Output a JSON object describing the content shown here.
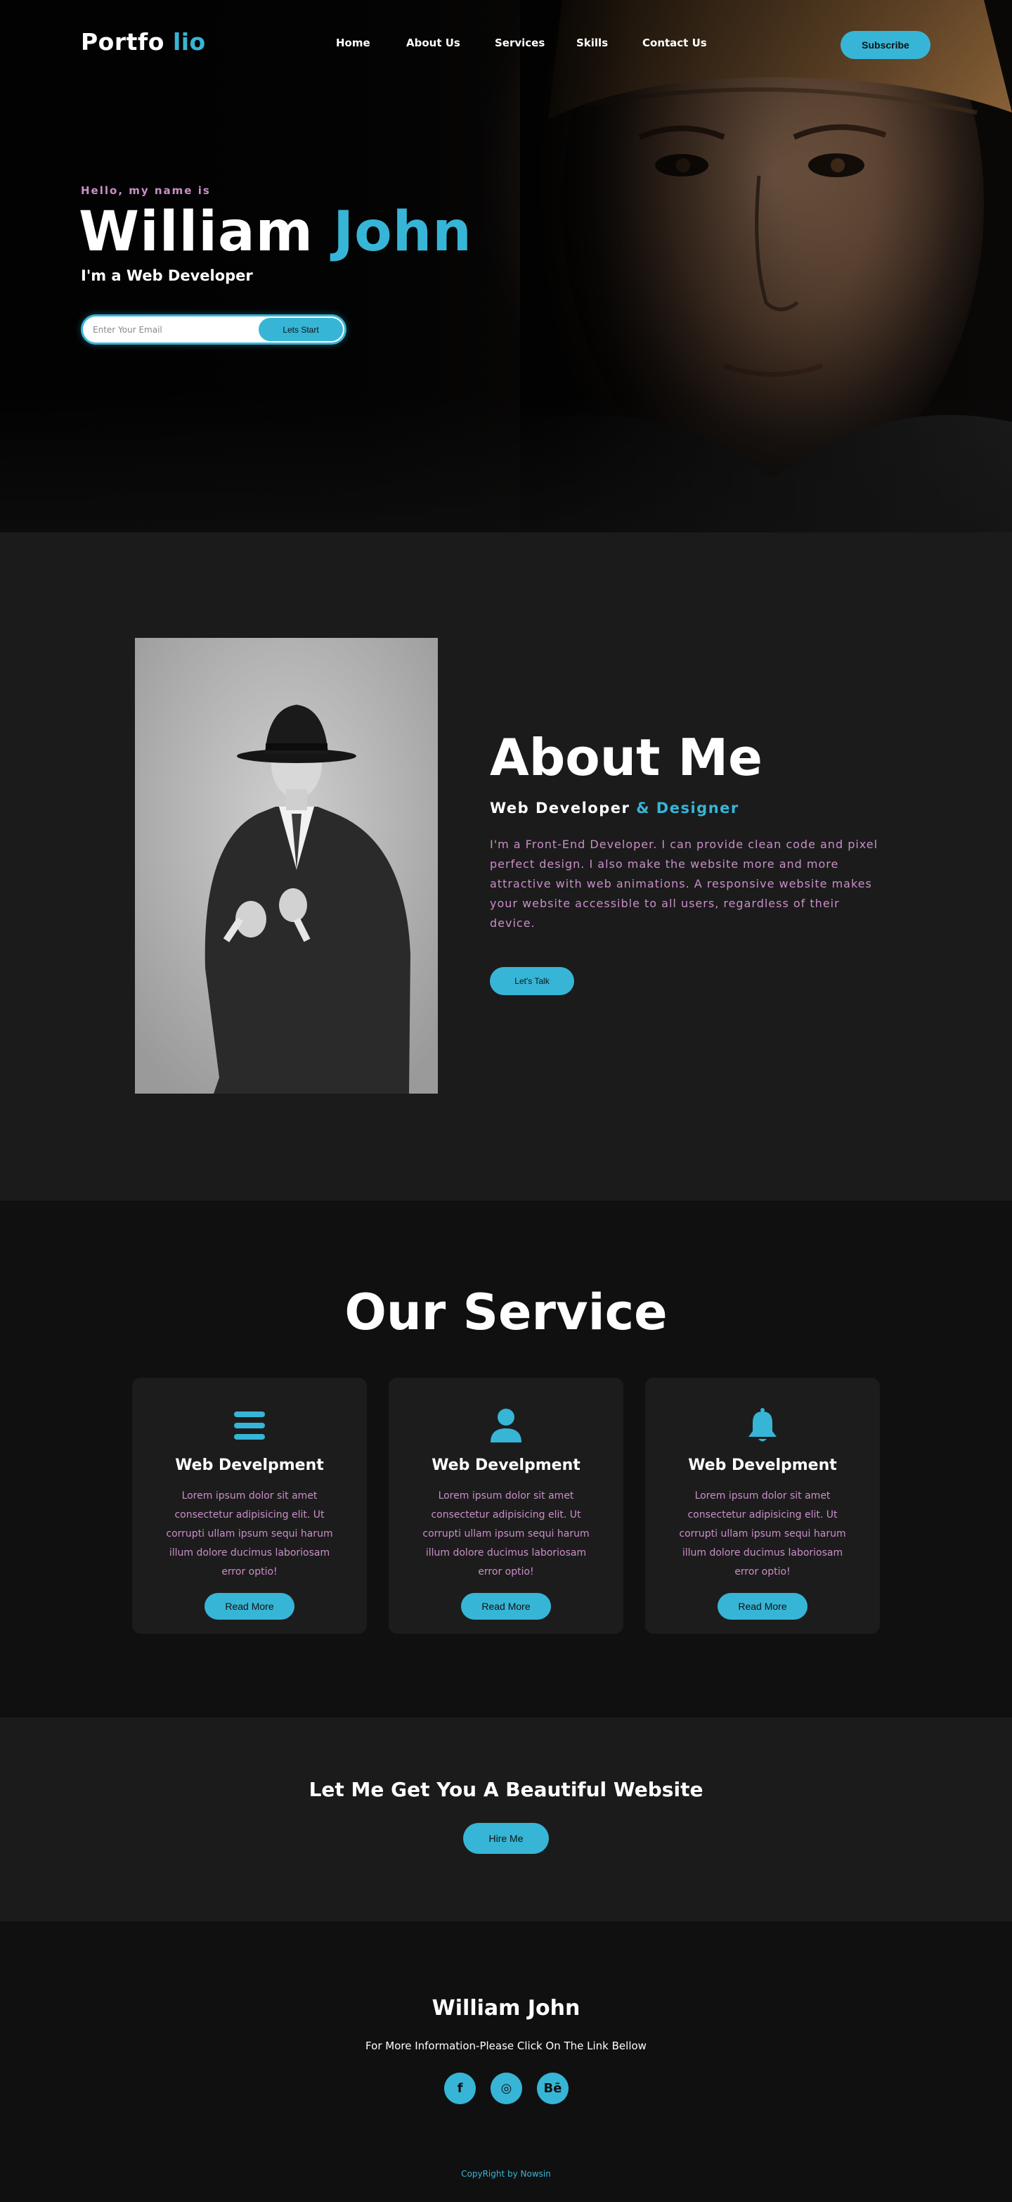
{
  "colors": {
    "accent": "#37b5d6",
    "pink_text": "#c98fc8",
    "bg_dark": "#101010",
    "bg_section": "#1b1b1b",
    "card_bg": "#1c1c1c"
  },
  "nav": {
    "logo_main": "Portfo",
    "logo_accent": "lio",
    "links": [
      "Home",
      "About Us",
      "Services",
      "Skills",
      "Contact Us"
    ],
    "subscribe_label": "Subscribe"
  },
  "hero": {
    "hello": "Hello, my name is",
    "first_name": "William",
    "last_name": "John",
    "role": "I'm a Web Developer",
    "email_placeholder": "Enter Your Email",
    "start_label": "Lets Start"
  },
  "about": {
    "title": "About Me",
    "subtitle_main": "Web Developer",
    "subtitle_accent": "& Designer",
    "text": "I'm a Front-End Developer. I can provide clean code and pixel perfect design. I also make the website more and more attractive with web animations. A responsive website makes your website accessible to all users, regardless of their device.",
    "button_label": "Let's Talk"
  },
  "services": {
    "title": "Our Service",
    "cards": [
      {
        "icon": "menu-bars-icon",
        "title": "Web Develpment",
        "text": "Lorem ipsum dolor sit amet consectetur adipisicing elit. Ut corrupti ullam ipsum sequi harum illum dolore ducimus laboriosam error optio!",
        "button": "Read More"
      },
      {
        "icon": "user-icon",
        "title": "Web Develpment",
        "text": "Lorem ipsum dolor sit amet consectetur adipisicing elit. Ut corrupti ullam ipsum sequi harum illum dolore ducimus laboriosam error optio!",
        "button": "Read More"
      },
      {
        "icon": "bell-icon",
        "title": "Web Develpment",
        "text": "Lorem ipsum dolor sit amet consectetur adipisicing elit. Ut corrupti ullam ipsum sequi harum illum dolore ducimus laboriosam error optio!",
        "button": "Read More"
      }
    ]
  },
  "cta": {
    "title": "Let Me Get You A Beautiful Website",
    "button_label": "Hire Me"
  },
  "footer": {
    "name": "William John",
    "info": "For More Information-Please Click On The Link Bellow",
    "socials": [
      {
        "icon": "facebook-icon",
        "glyph": "f"
      },
      {
        "icon": "instagram-icon",
        "glyph": "◎"
      },
      {
        "icon": "behance-icon",
        "glyph": "Bē"
      }
    ],
    "copyright": "CopyRight by Nowsin"
  }
}
